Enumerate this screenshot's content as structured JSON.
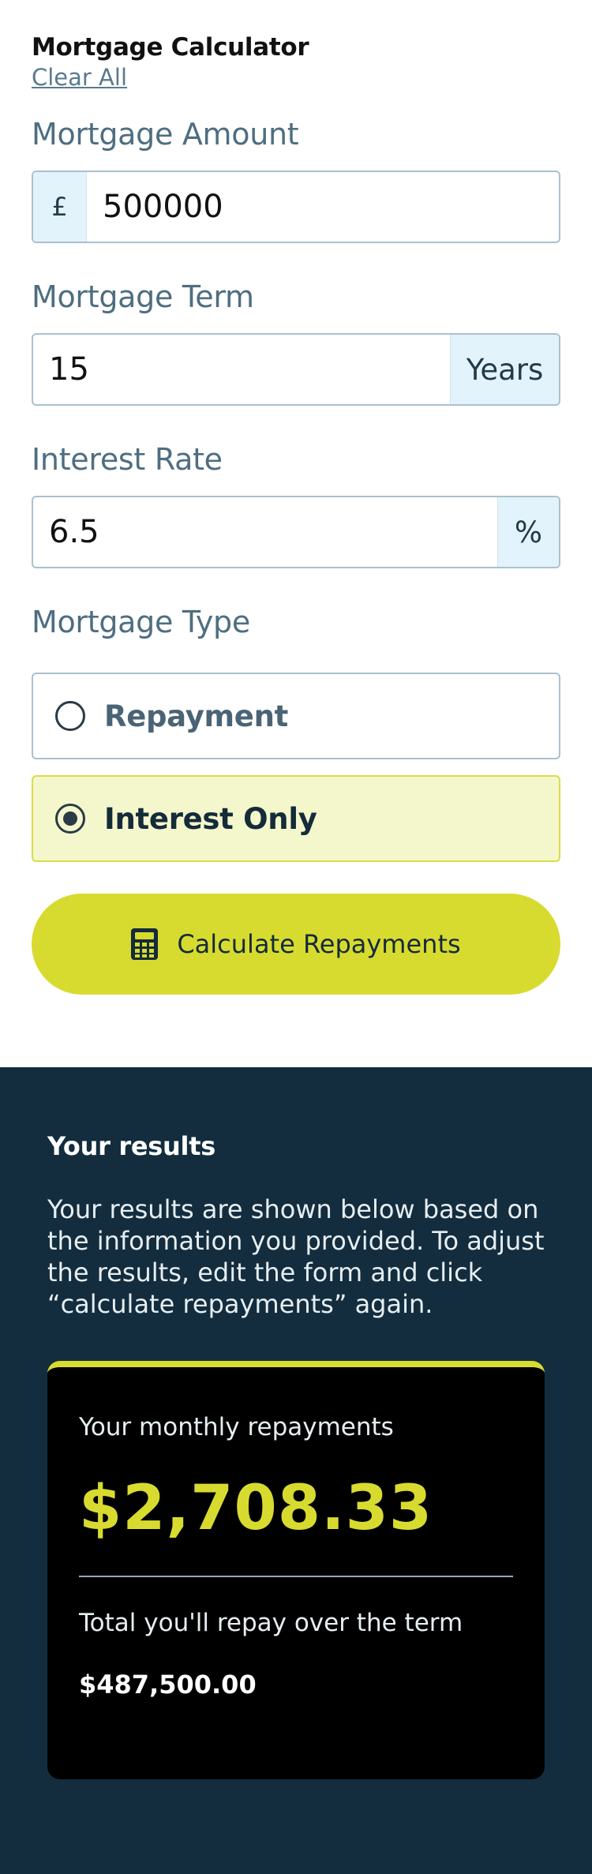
{
  "header": {
    "title": "Mortgage Calculator",
    "clear_label": "Clear All"
  },
  "form": {
    "amount": {
      "label": "Mortgage Amount",
      "prefix": "£",
      "value": "500000"
    },
    "term": {
      "label": "Mortgage Term",
      "value": "15",
      "suffix": "Years"
    },
    "rate": {
      "label": "Interest Rate",
      "value": "6.5",
      "suffix": "%"
    },
    "type": {
      "label": "Mortgage Type",
      "options": [
        {
          "label": "Repayment",
          "selected": false
        },
        {
          "label": "Interest Only",
          "selected": true
        }
      ]
    },
    "submit_label": "Calculate Repayments",
    "submit_icon": "calculator-icon"
  },
  "results": {
    "title": "Your results",
    "description": "Your results are shown below based on the information you provided. To adjust the results, edit the form and click “calculate repayments” again.",
    "monthly_label": "Your monthly repayments",
    "monthly_value": "$2,708.33",
    "total_label": "Total you'll repay over the term",
    "total_value": "$487,500.00"
  },
  "colors": {
    "accent": "#d8db2f",
    "dark_panel": "#132d3e",
    "input_affix": "#e3f3fb",
    "selected_option_bg": "#f4f6cc"
  }
}
